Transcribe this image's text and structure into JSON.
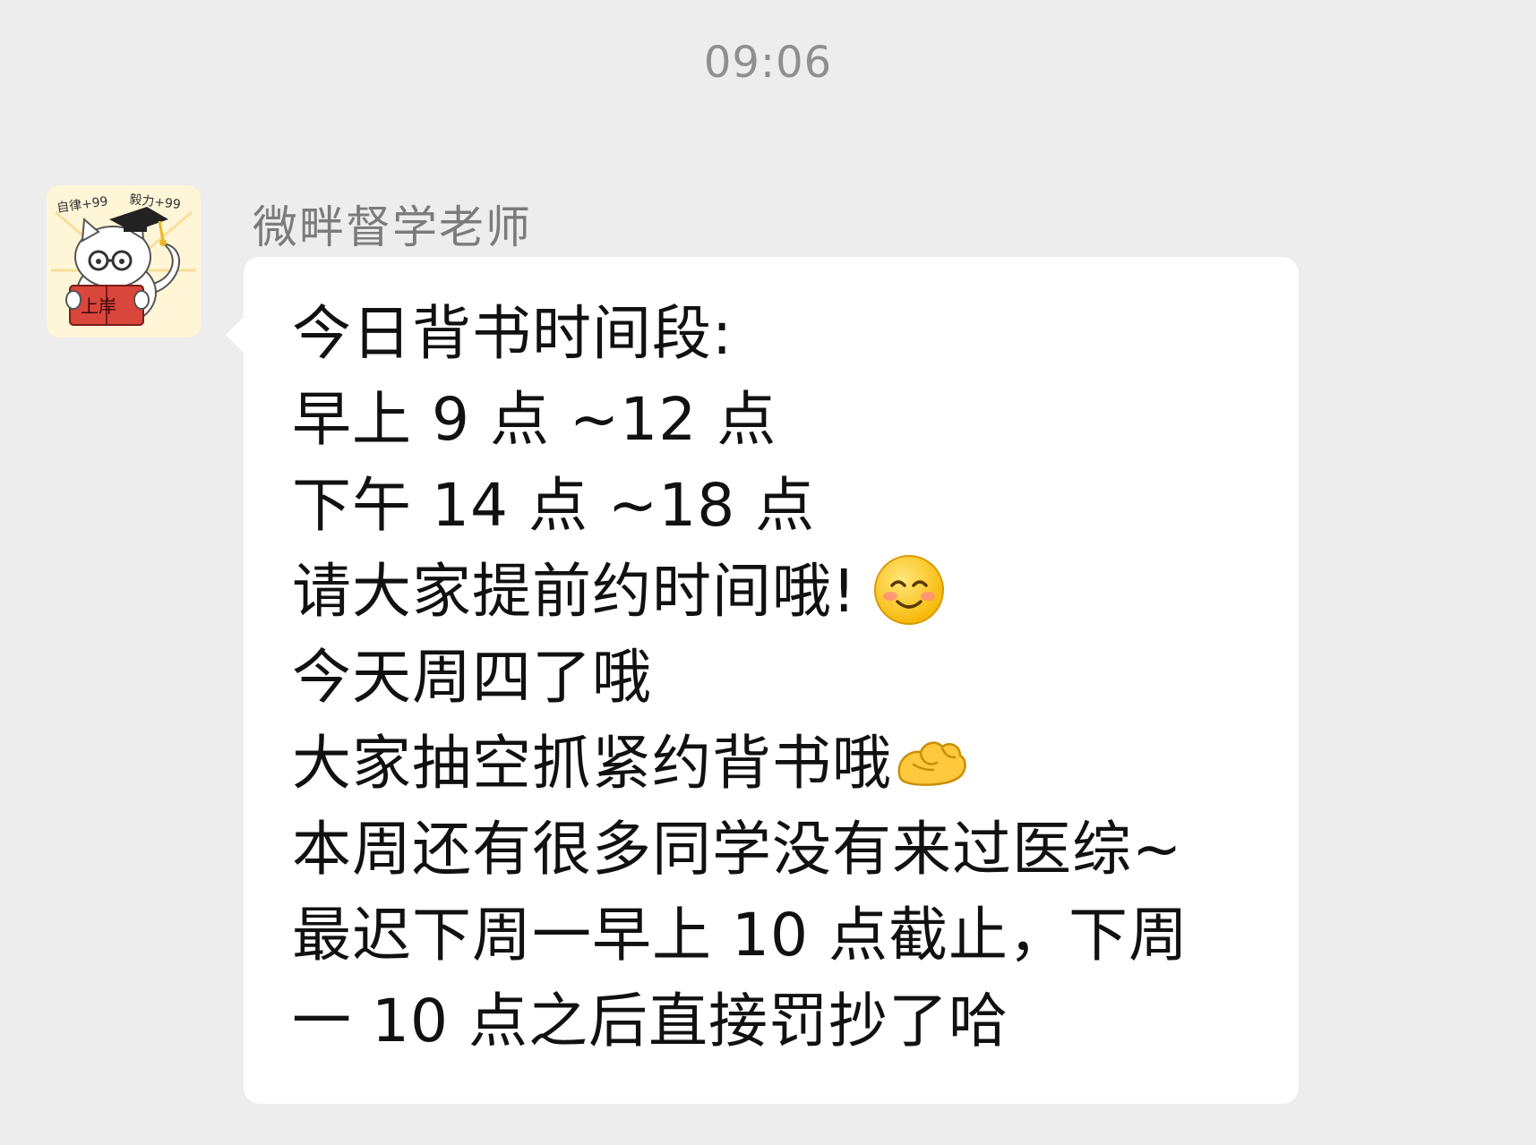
{
  "timestamp": "09:06",
  "sender": {
    "name": "微畔督学老师",
    "avatar_icon": "cat-scholar-avatar-icon",
    "avatar_text": {
      "banner_left": "自律+99",
      "banner_right": "毅力+99",
      "book": "上岸"
    }
  },
  "message": {
    "lines": [
      "今日背书时间段:",
      "早上 9 点 ~12 点",
      "下午 14 点 ~18 点",
      "请大家提前约时间哦!",
      "今天周四了哦",
      "大家抽空抓紧约背书哦",
      "本周还有很多同学没有来过医综~",
      "最迟下周一早上 10 点截止，下周",
      "一 10 点之后直接罚抄了哈"
    ],
    "emojis": {
      "line_4": "smiling-face-emoji-icon",
      "line_6": "flexed-biceps-emoji-icon"
    }
  }
}
